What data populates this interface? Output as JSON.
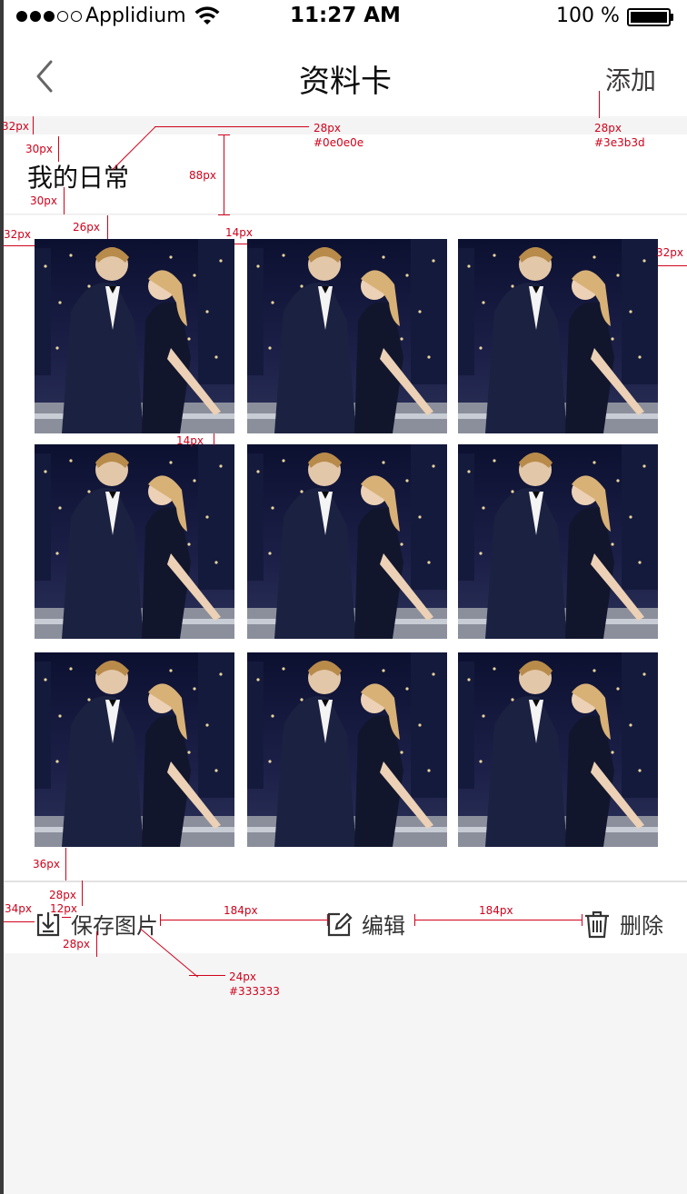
{
  "status_bar": {
    "carrier": "Applidium",
    "time": "11:27 AM",
    "battery": "100 %"
  },
  "nav": {
    "title": "资料卡",
    "action": "添加"
  },
  "section": {
    "title": "我的日常"
  },
  "photos": {
    "count": 9
  },
  "toolbar": {
    "save": "保存图片",
    "edit": "编辑",
    "delete": "删除"
  },
  "annotations": {
    "a1": "32px",
    "a2": "30px",
    "a3": "28px",
    "a3c": "#0e0e0e",
    "a4": "88px",
    "a5": "30px",
    "a6": "32px",
    "a7": "26px",
    "a8": "14px",
    "a9": "28px",
    "a9c": "#3e3b3d",
    "a10": "32px",
    "a11": "14px",
    "a12": "36px",
    "a13": "28px",
    "a14": "34px",
    "a15": "12px",
    "a16": "184px",
    "a17": "184px",
    "a18": "28px",
    "a19": "24px",
    "a19c": "#333333"
  },
  "colors": {
    "title": "#0e0e0e",
    "action": "#3e3b3d",
    "toolbar_text": "#333333",
    "redline": "#d0021b"
  }
}
